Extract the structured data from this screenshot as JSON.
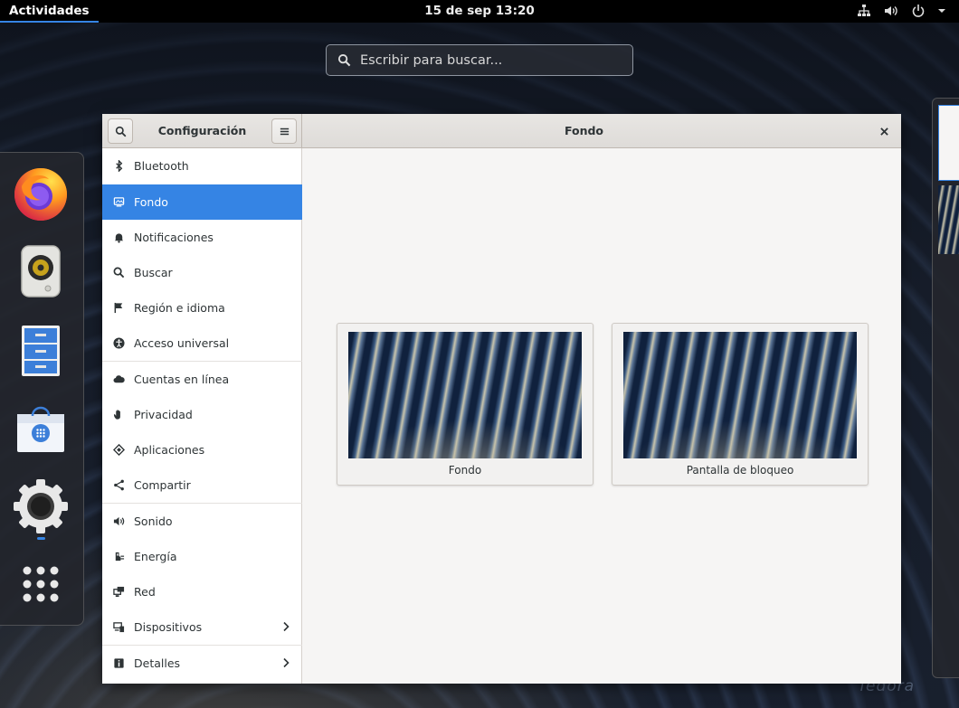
{
  "topbar": {
    "activities": "Actividades",
    "clock": "15 de sep  13:20",
    "tray_icons": [
      "network-icon",
      "volume-icon",
      "power-icon"
    ]
  },
  "search": {
    "placeholder": "Escribir para buscar..."
  },
  "dash": {
    "apps": [
      "firefox-icon",
      "rhythmbox-icon",
      "files-icon",
      "software-store-icon",
      "settings-app-icon",
      "show-applications-icon"
    ],
    "running_app": "settings-app-icon"
  },
  "window": {
    "sidebar_title": "Configuración",
    "page_title": "Fondo",
    "sidebar_items": [
      {
        "label": "Bluetooth",
        "icon": "bluetooth-icon"
      },
      {
        "label": "Fondo",
        "icon": "background-icon",
        "active": true
      },
      {
        "label": "Notificaciones",
        "icon": "bell-icon"
      },
      {
        "label": "Buscar",
        "icon": "search-icon"
      },
      {
        "label": "Región e idioma",
        "icon": "flag-icon"
      },
      {
        "label": "Acceso universal",
        "icon": "accessibility-icon"
      },
      {
        "label": "Cuentas en línea",
        "icon": "cloud-icon"
      },
      {
        "label": "Privacidad",
        "icon": "hand-icon"
      },
      {
        "label": "Aplicaciones",
        "icon": "applications-icon"
      },
      {
        "label": "Compartir",
        "icon": "share-icon"
      },
      {
        "label": "Sonido",
        "icon": "speaker-icon"
      },
      {
        "label": "Energía",
        "icon": "power-plug-icon"
      },
      {
        "label": "Red",
        "icon": "network-wired-icon"
      },
      {
        "label": "Dispositivos",
        "icon": "devices-icon",
        "has_submenu": true
      },
      {
        "label": "Detalles",
        "icon": "info-icon",
        "has_submenu": true
      }
    ],
    "cards": [
      {
        "caption": "Fondo"
      },
      {
        "caption": "Pantalla de bloqueo"
      }
    ]
  },
  "watermark": "fedora",
  "colors": {
    "accent": "#3584e4",
    "topbar": "#000000",
    "window_bg": "#f6f5f4"
  }
}
